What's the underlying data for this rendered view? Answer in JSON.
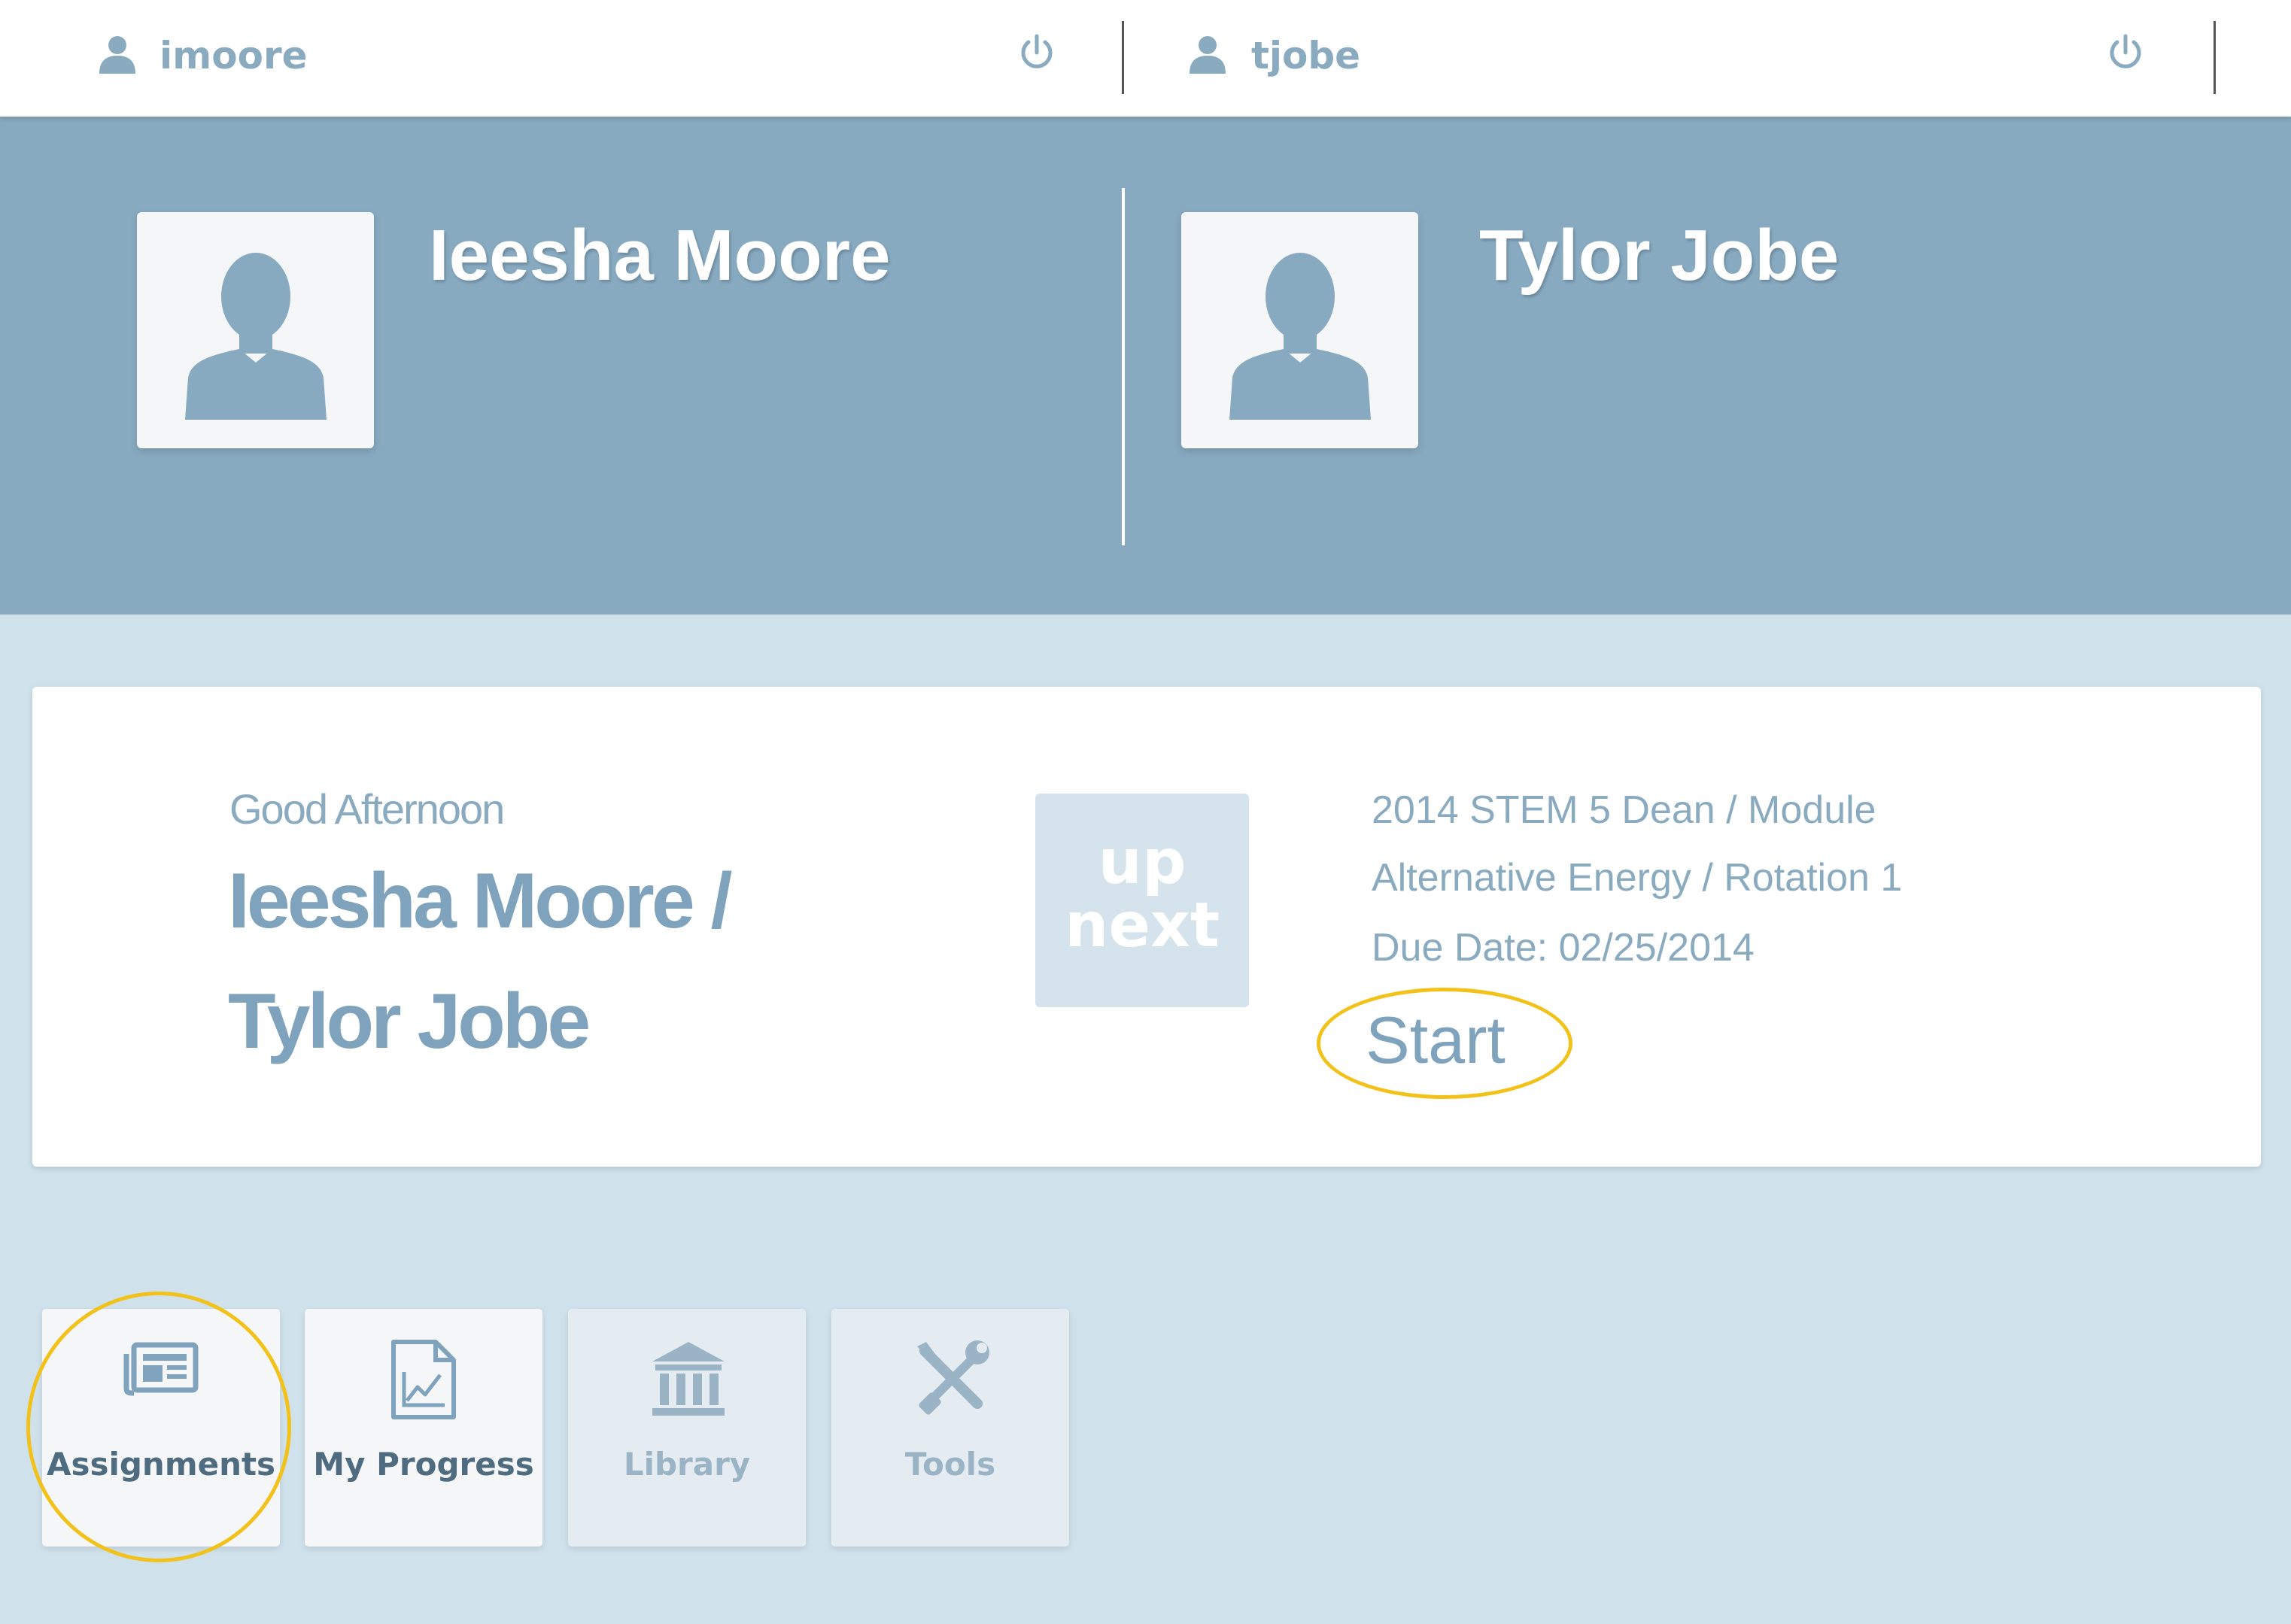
{
  "users": [
    {
      "username": "imoore",
      "full_name": "Ieesha Moore"
    },
    {
      "username": "tjobe",
      "full_name": "Tylor Jobe"
    }
  ],
  "card": {
    "greeting": "Good Afternoon",
    "names": "Ieesha Moore / Tylor Jobe",
    "upnext_line1": "up",
    "upnext_line2": "next",
    "assignment_line1": "2014 STEM 5 Dean / Module",
    "assignment_line2": "Alternative Energy / Rotation 1",
    "due_date": "Due Date: 02/25/2014",
    "start_label": "Start"
  },
  "tiles": [
    {
      "label": "Assignments",
      "icon": "assignments-icon",
      "state": "active"
    },
    {
      "label": "My Progress",
      "icon": "progress-chart-icon",
      "state": "active"
    },
    {
      "label": "Library",
      "icon": "library-icon",
      "state": "inactive"
    },
    {
      "label": "Tools",
      "icon": "tools-icon",
      "state": "inactive"
    }
  ],
  "colors": {
    "header_bg": "#88aac0",
    "page_bg": "#cfe1eb",
    "text_accent": "#8aaac0",
    "highlight_ring": "#f2c21a"
  }
}
